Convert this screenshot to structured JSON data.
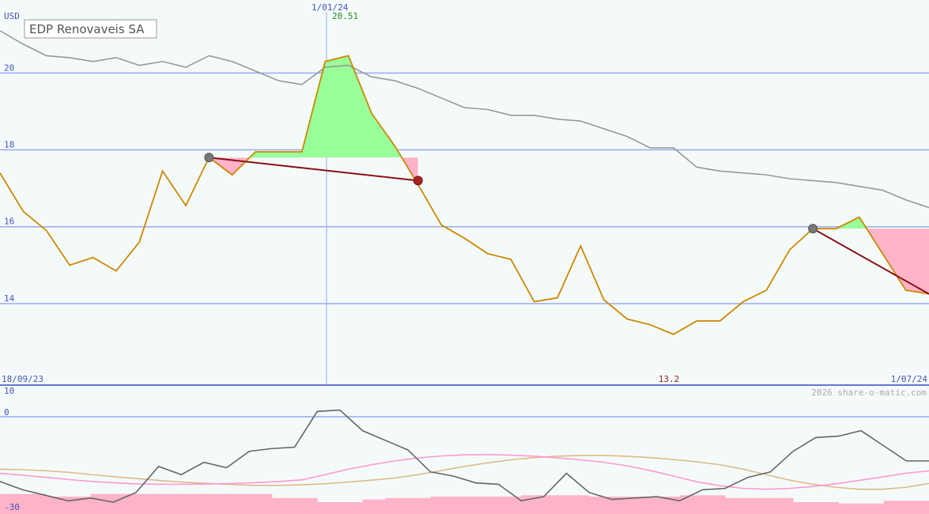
{
  "chart_data": [
    {
      "type": "line",
      "title": "EDP Renovaveis SA",
      "currency_label": "USD",
      "x_start_label": "18/09/23",
      "x_end_label": "1/07/24",
      "marker": {
        "label": "1/01/24",
        "value_label": "20.51"
      },
      "low_label": "13.2",
      "ylim": [
        11.9,
        21.9
      ],
      "y_ticks": [
        14,
        16,
        18,
        20
      ],
      "y_tick_labels": [
        "14",
        "16",
        "18",
        "20"
      ],
      "grid": "horizontal",
      "colors": {
        "price": "#cc8800",
        "average": "#999999",
        "gain": "#99ff99",
        "loss": "#ffb3c9",
        "grid": "#99aaee",
        "trend": "#881111"
      },
      "series": [
        {
          "role": "price",
          "values": [
            17.4,
            16.4,
            15.9,
            15.0,
            15.2,
            14.85,
            15.6,
            17.45,
            16.55,
            17.8,
            17.35,
            17.95,
            17.95,
            17.95,
            20.3,
            20.45,
            18.95,
            18.1,
            17.1,
            16.05,
            15.7,
            15.3,
            15.15,
            14.05,
            14.15,
            15.5,
            14.1,
            13.6,
            13.45,
            13.2,
            13.55,
            13.55,
            14.05,
            14.35,
            15.4,
            15.95,
            15.95,
            16.25,
            15.3,
            14.35,
            14.25
          ]
        },
        {
          "role": "average",
          "values": [
            21.1,
            20.75,
            20.45,
            20.4,
            20.3,
            20.4,
            20.2,
            20.3,
            20.15,
            20.45,
            20.3,
            20.05,
            19.8,
            19.7,
            20.15,
            20.2,
            19.9,
            19.8,
            19.6,
            19.35,
            19.1,
            19.05,
            18.9,
            18.9,
            18.8,
            18.75,
            18.55,
            18.35,
            18.05,
            18.05,
            17.55,
            17.45,
            17.4,
            17.35,
            17.25,
            17.2,
            17.15,
            17.05,
            16.95,
            16.7,
            16.5
          ]
        }
      ],
      "trades": [
        {
          "entry_index": 9,
          "exit_index": 18,
          "entry_value": 17.8,
          "exit_value": 17.2
        },
        {
          "entry_index": 35,
          "exit_index": 40,
          "entry_value": 15.95,
          "exit_value": 14.25
        }
      ]
    },
    {
      "type": "line",
      "ylim": [
        -30,
        10
      ],
      "y_ticks": [
        10,
        0,
        -30
      ],
      "y_tick_labels": [
        "10",
        "0",
        "-30"
      ],
      "zero_line": 0,
      "colors": {
        "momentum": "#666666",
        "slow": "#ddbb88",
        "fast": "#ff99cc",
        "bars": "#ffb3c9"
      },
      "series": [
        {
          "role": "momentum",
          "values": [
            -22.5,
            -25.5,
            -27.5,
            -29.5,
            -28.5,
            -30.0,
            -26.5,
            -17.0,
            -20.0,
            -15.5,
            -17.5,
            -11.5,
            -10.5,
            -10.0,
            3.0,
            3.5,
            -4.0,
            -7.5,
            -11.0,
            -19.0,
            -20.5,
            -23.0,
            -23.5,
            -29.5,
            -28.0,
            -19.5,
            -26.5,
            -29.0,
            -28.5,
            -28.0,
            -29.5,
            -25.5,
            -25.0,
            -21.0,
            -19.0,
            -11.5,
            -6.5,
            -6.0,
            -4.0,
            -9.5,
            -15.0,
            -15.0
          ]
        },
        {
          "role": "slow",
          "values": [
            -18.0,
            -18.2,
            -18.6,
            -19.2,
            -20.0,
            -20.8,
            -21.5,
            -22.2,
            -22.8,
            -23.2,
            -23.6,
            -23.9,
            -23.9,
            -23.7,
            -23.3,
            -22.7,
            -22.0,
            -21.2,
            -20.0,
            -18.5,
            -17.0,
            -15.7,
            -14.6,
            -13.8,
            -13.3,
            -13.0,
            -13.0,
            -13.3,
            -13.8,
            -14.5,
            -15.3,
            -16.4,
            -18.0,
            -20.0,
            -22.0,
            -23.5,
            -24.6,
            -25.3,
            -25.3,
            -24.6,
            -23.2
          ]
        },
        {
          "role": "fast",
          "values": [
            -19.5,
            -20.2,
            -21.0,
            -21.8,
            -22.5,
            -23.0,
            -23.4,
            -23.5,
            -23.5,
            -23.4,
            -23.2,
            -22.9,
            -22.5,
            -21.9,
            -20.0,
            -18.0,
            -16.4,
            -15.0,
            -13.9,
            -13.2,
            -12.8,
            -12.7,
            -12.9,
            -13.3,
            -13.9,
            -14.6,
            -15.5,
            -16.8,
            -18.5,
            -20.5,
            -22.6,
            -24.0,
            -25.0,
            -25.3,
            -25.0,
            -24.3,
            -23.3,
            -22.1,
            -20.8,
            -19.5,
            -18.6
          ]
        },
        {
          "role": "bars",
          "values": [
            -27.0,
            -27.0,
            -28.0,
            -28.0,
            -27.0,
            -27.0,
            -27.0,
            -27.0,
            -27.0,
            -27.0,
            -27.0,
            -27.0,
            -28.5,
            -28.5,
            -30.0,
            -30.0,
            -29.0,
            -28.5,
            -28.5,
            -28.0,
            -28.0,
            -28.0,
            -28.0,
            -27.5,
            -27.5,
            -27.5,
            -28.0,
            -28.0,
            -28.0,
            -28.0,
            -27.5,
            -27.5,
            -28.5,
            -28.5,
            -28.5,
            -30.0,
            -30.0,
            -30.5,
            -30.5,
            -29.5,
            -29.5
          ]
        }
      ]
    }
  ],
  "watermark": "2026 share-o-matic.com"
}
